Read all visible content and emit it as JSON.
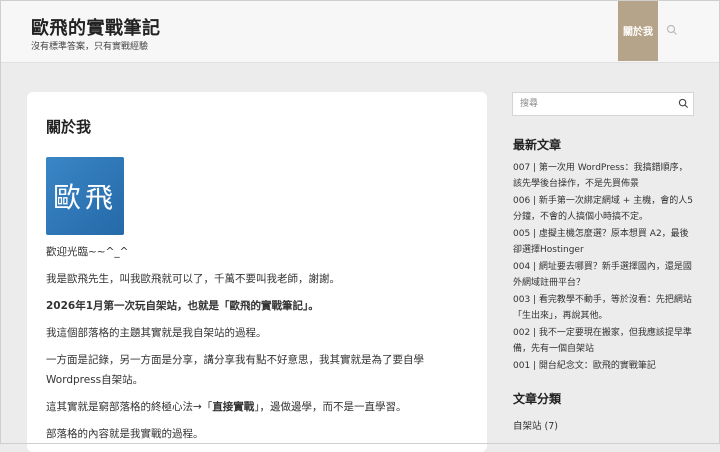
{
  "site": {
    "title": "歐飛的實戰筆記",
    "tagline": "沒有標準答案，只有實戰經驗",
    "nav_about": "關於我",
    "search_icon": "search-icon"
  },
  "page": {
    "title": "關於我",
    "logo_text": "歐飛",
    "paragraphs": [
      "歡迎光臨~~^_^",
      "我是歐飛先生，叫我歐飛就可以了，千萬不要叫我老師，謝謝。",
      "2026年1月第一次玩自架站，也就是「歐飛的實戰筆記」。",
      "我這個部落格的主題其實就是我自架站的過程。",
      "一方面是記錄，另一方面是分享，講分享我有點不好意思，我其實就是為了要自學Wordpress自架站。",
      "這其實就是窮部落格的終極心法→「",
      "直接實戰",
      "」，邊做邊學，而不是一直學習。",
      "部落格的內容就是我實戰的過程。"
    ]
  },
  "sidebar": {
    "search_placeholder": "搜尋",
    "recent_title": "最新文章",
    "recent_posts": [
      "007 | 第一次用 WordPress：我搞錯順序，該先學後台操作，不是先買佈景",
      "006 | 新手第一次綁定網域 + 主機，會的人5分鐘，不會的人搞個小時搞不定。",
      "005 | 虛擬主機怎麼選？原本想買 A2，最後卻選擇Hostinger",
      "004 | 網址要去哪買？新手選擇國內，還是國外網域註冊平台？",
      "003 | 看完教學不動手，等於沒看：先把網站「生出來」，再說其他。",
      "002 | 我不一定要現在搬家，但我應該提早準備，先有一個自架站",
      "001 | 開台紀念文：歐飛的實戰筆記"
    ],
    "category_title": "文章分類",
    "category_label": "自架站",
    "category_count": "(7)"
  }
}
